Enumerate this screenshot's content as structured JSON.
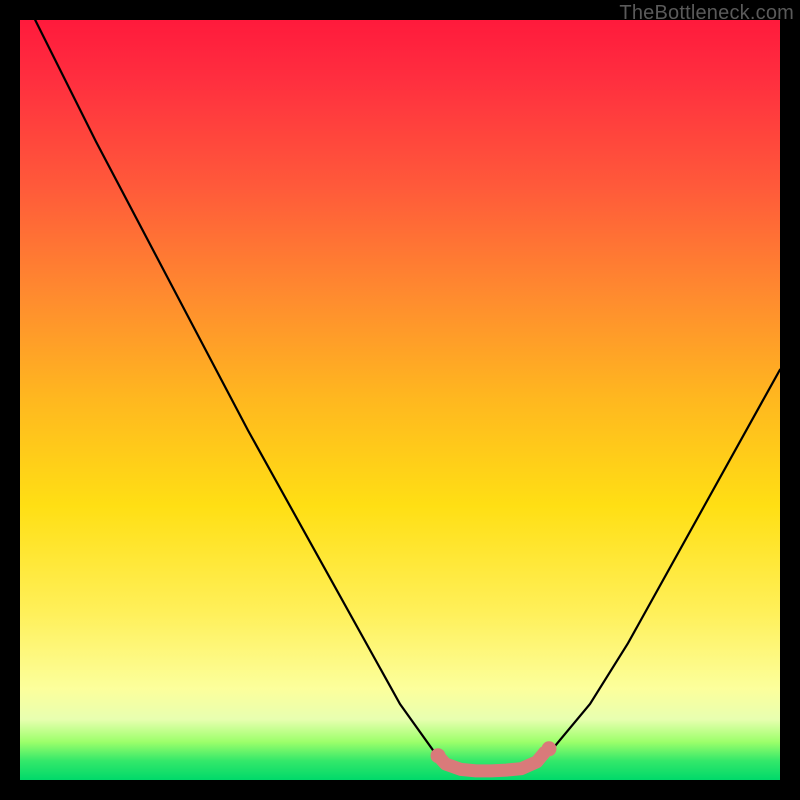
{
  "watermark": "TheBottleneck.com",
  "chart_data": {
    "type": "line",
    "title": "",
    "xlabel": "",
    "ylabel": "",
    "xlim": [
      0,
      100
    ],
    "ylim": [
      0,
      100
    ],
    "series": [
      {
        "name": "bottleneck-curve",
        "x": [
          2,
          10,
          20,
          30,
          40,
          50,
          55,
          58,
          60,
          62,
          65,
          68,
          70,
          75,
          80,
          90,
          100
        ],
        "values": [
          100,
          84,
          65,
          46,
          28,
          10,
          3,
          1,
          1,
          1,
          1,
          2,
          4,
          10,
          18,
          36,
          54
        ]
      }
    ],
    "highlight": {
      "name": "flat-bottom-marker",
      "color": "#d97a7a",
      "x": [
        55,
        56,
        58,
        60,
        62,
        64,
        66,
        68,
        69
      ],
      "values": [
        3.2,
        2.1,
        1.4,
        1.2,
        1.2,
        1.3,
        1.5,
        2.4,
        3.6
      ]
    }
  }
}
